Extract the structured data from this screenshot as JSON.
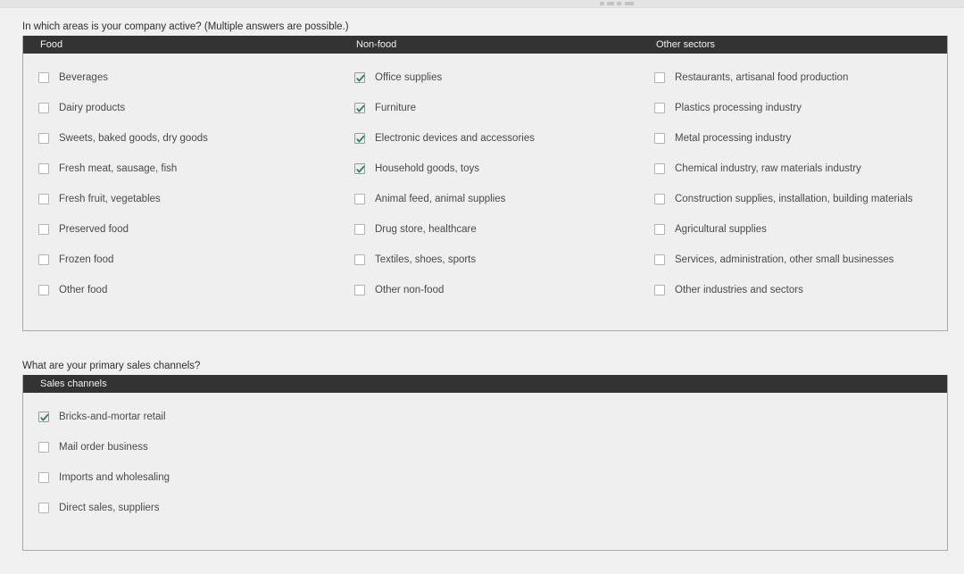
{
  "page": {
    "background_color": "#f0f0f0",
    "header_bar_color": "#333333",
    "check_color": "#1f7a6a"
  },
  "sections": [
    {
      "id": "areas",
      "question": "In which areas is your company active? (Multiple answers are possible.)",
      "columns": [
        {
          "header": "Food",
          "options": [
            {
              "label": "Beverages",
              "checked": false
            },
            {
              "label": "Dairy products",
              "checked": false
            },
            {
              "label": "Sweets, baked goods, dry goods",
              "checked": false
            },
            {
              "label": "Fresh meat, sausage, fish",
              "checked": false
            },
            {
              "label": "Fresh fruit, vegetables",
              "checked": false
            },
            {
              "label": "Preserved food",
              "checked": false
            },
            {
              "label": "Frozen food",
              "checked": false
            },
            {
              "label": "Other food",
              "checked": false
            }
          ]
        },
        {
          "header": "Non-food",
          "options": [
            {
              "label": "Office supplies",
              "checked": true
            },
            {
              "label": "Furniture",
              "checked": true
            },
            {
              "label": "Electronic devices and accessories",
              "checked": true
            },
            {
              "label": "Household goods, toys",
              "checked": true
            },
            {
              "label": "Animal feed, animal supplies",
              "checked": false
            },
            {
              "label": "Drug store, healthcare",
              "checked": false
            },
            {
              "label": "Textiles, shoes, sports",
              "checked": false
            },
            {
              "label": "Other non-food",
              "checked": false
            }
          ]
        },
        {
          "header": "Other sectors",
          "options": [
            {
              "label": "Restaurants, artisanal food production",
              "checked": false
            },
            {
              "label": "Plastics processing industry",
              "checked": false
            },
            {
              "label": "Metal processing industry",
              "checked": false
            },
            {
              "label": "Chemical industry, raw materials industry",
              "checked": false
            },
            {
              "label": "Construction supplies, installation, building materials",
              "checked": false
            },
            {
              "label": "Agricultural supplies",
              "checked": false
            },
            {
              "label": "Services, administration, other small businesses",
              "checked": false
            },
            {
              "label": "Other industries and sectors",
              "checked": false
            }
          ]
        }
      ]
    },
    {
      "id": "channels",
      "question": "What are your primary sales channels?",
      "columns": [
        {
          "header": "Sales channels",
          "options": [
            {
              "label": "Bricks-and-mortar retail",
              "checked": true
            },
            {
              "label": "Mail order business",
              "checked": false
            },
            {
              "label": "Imports and wholesaling",
              "checked": false
            },
            {
              "label": "Direct sales, suppliers",
              "checked": false
            }
          ]
        }
      ]
    }
  ]
}
